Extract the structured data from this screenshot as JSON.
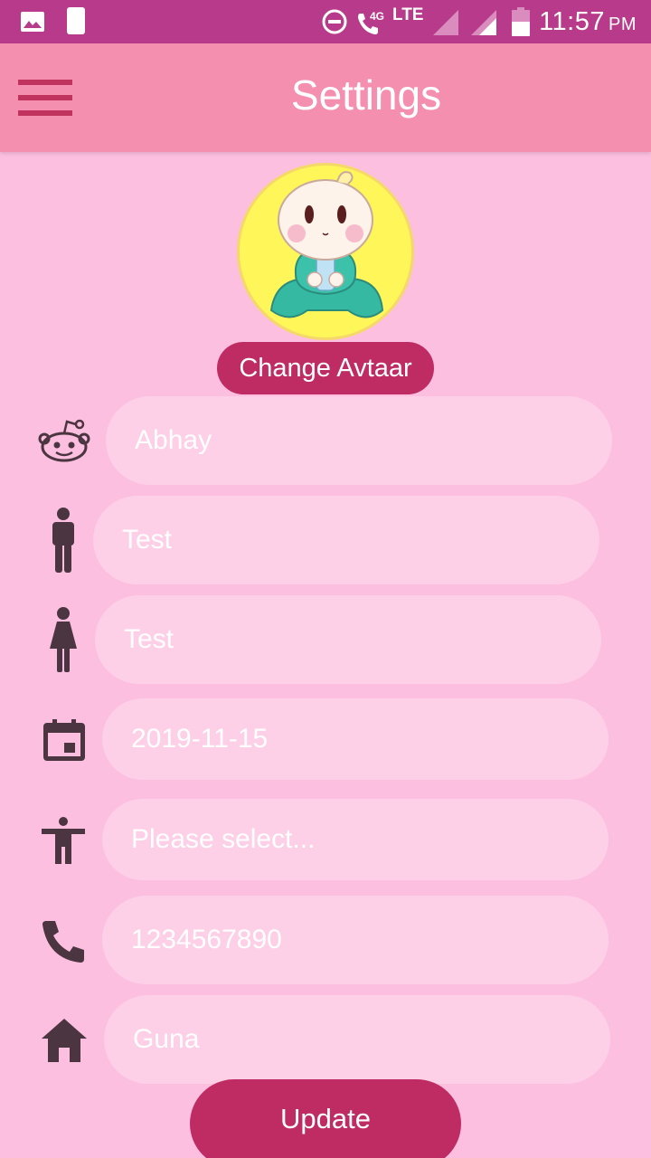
{
  "status_bar": {
    "network_label": "LTE",
    "network_sub": "4G",
    "time": "11:57",
    "ampm": "PM"
  },
  "app_bar": {
    "title": "Settings"
  },
  "profile": {
    "change_avatar_label": "Change Avtaar"
  },
  "form": {
    "name": "Abhay",
    "father_name": "Test",
    "mother_name": "Test",
    "dob": "2019-11-15",
    "gender_select": "Please select...",
    "phone": "1234567890",
    "address": "Guna"
  },
  "actions": {
    "update_label": "Update"
  },
  "colors": {
    "status_bar": "#b83a8a",
    "app_bar": "#f48fb0",
    "background": "#fdbfe0",
    "field": "#fdd0e8",
    "accent": "#bf2b63",
    "icon": "#4a3540"
  },
  "icons": [
    "image-icon",
    "sim-icon",
    "do-not-disturb-icon",
    "wifi-call-icon",
    "signal-icon",
    "battery-icon",
    "menu-icon",
    "reddit-alien-icon",
    "man-icon",
    "woman-icon",
    "calendar-icon",
    "accessibility-icon",
    "phone-icon",
    "home-icon"
  ]
}
